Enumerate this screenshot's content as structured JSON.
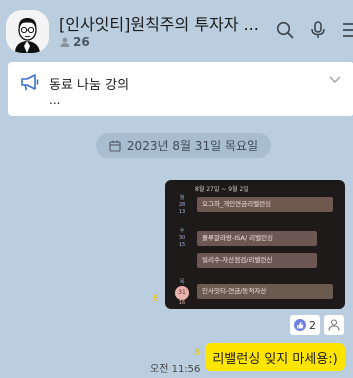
{
  "header": {
    "title": "[인사잇티]원칙주의 투자자 ...",
    "member_count": "26"
  },
  "notice": {
    "line1": "동료 나눔 강의",
    "line2": "..."
  },
  "date_divider": "2023년 8월 31일 목요일",
  "image_message": {
    "unread": "8",
    "calendar": {
      "range": "8월 27일 ~ 9월 2일",
      "days": [
        {
          "dow": "월",
          "date": "28",
          "num": "13"
        },
        {
          "dow": "수",
          "date": "30",
          "num": "15"
        },
        {
          "dow": "목",
          "date": "31",
          "num": "16"
        }
      ],
      "events": [
        {
          "label": "오그하_개인연금리밸런싱",
          "color": "#6f5850"
        },
        {
          "label": "풀루알라랑-ISA/ 리밸런싱",
          "color": "#6d5752"
        },
        {
          "label": "빌리수-자산점검/리밸런신",
          "color": "#6d5752"
        },
        {
          "label": "인사잇티-연금/동적자산",
          "color": "#6a5a50"
        }
      ]
    }
  },
  "reactions": {
    "like_count": "2"
  },
  "text_message": {
    "unread": "8",
    "time": "오전 11:56",
    "text": "리밸런싱 잊지 마세용:)"
  },
  "colors": {
    "background": "#bacee0",
    "bubble": "#fee500",
    "unread": "#f2c400"
  }
}
